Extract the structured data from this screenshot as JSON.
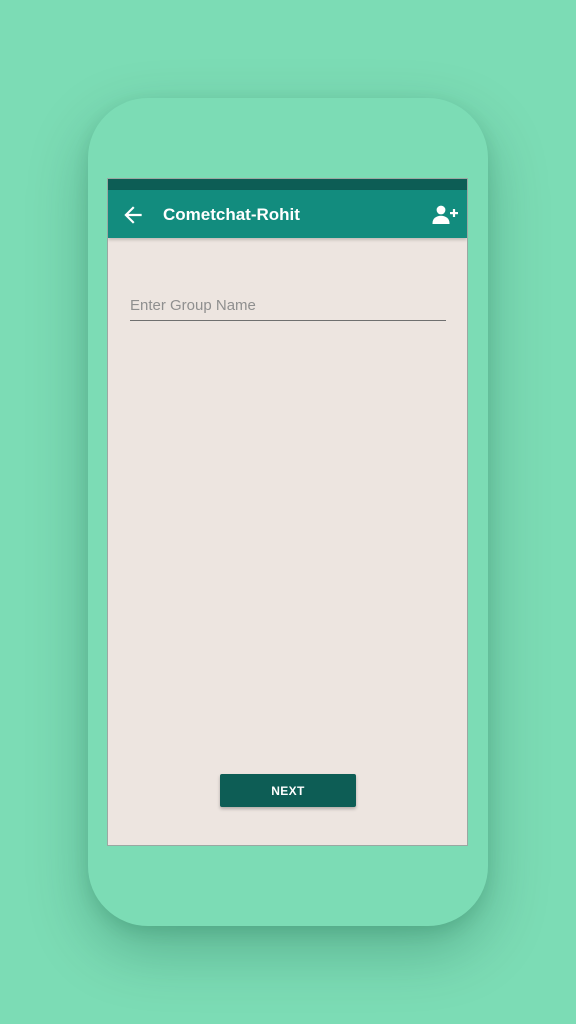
{
  "colors": {
    "background": "#7cdcb5",
    "status_bar": "#0d5d55",
    "app_bar": "#128c7e",
    "screen_background": "#ede5e0",
    "button": "#0d5d55"
  },
  "app_bar": {
    "back_icon": "arrow-back-icon",
    "title": "Cometchat-Rohit",
    "action_icon": "add-person-icon"
  },
  "form": {
    "group_name_placeholder": "Enter Group Name",
    "group_name_value": ""
  },
  "footer": {
    "next_label": "NEXT"
  }
}
